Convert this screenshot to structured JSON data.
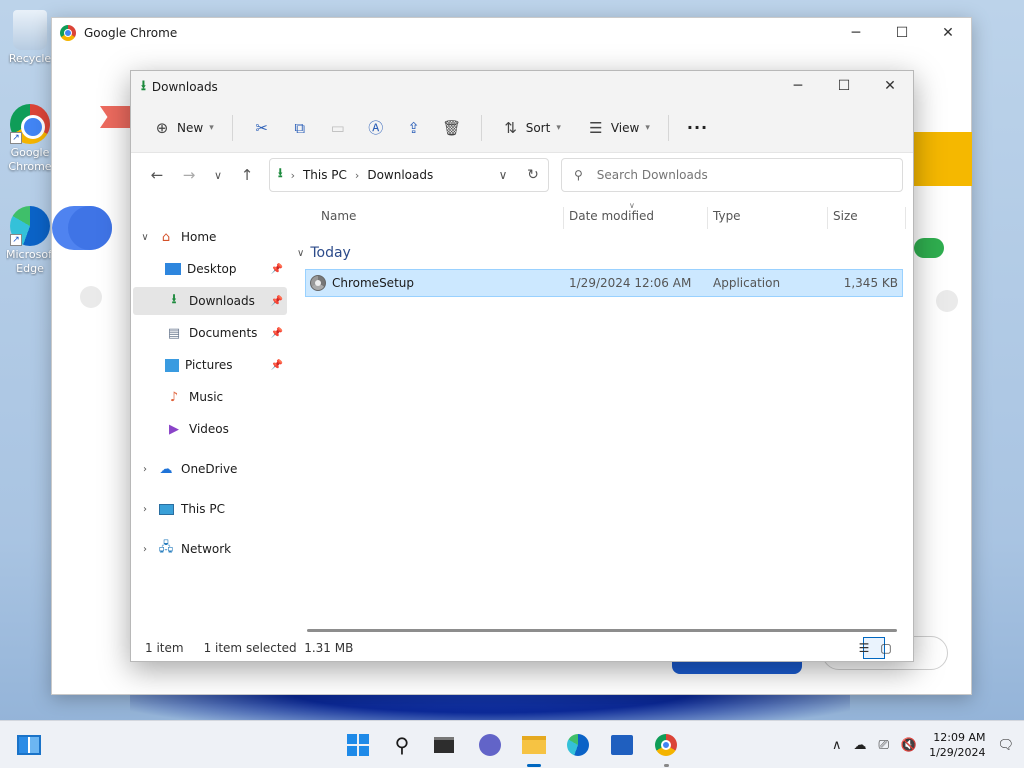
{
  "desktop": {
    "icons": [
      {
        "label": "Recycle",
        "icon": "recycle-bin-icon"
      },
      {
        "label": "Google Chrome",
        "icon": "chrome-icon"
      },
      {
        "label": "Microsoft Edge",
        "icon": "edge-icon"
      }
    ]
  },
  "chrome_window": {
    "title": "Google Chrome"
  },
  "explorer": {
    "title": "Downloads",
    "toolbar": {
      "new_label": "New",
      "sort_label": "Sort",
      "view_label": "View",
      "more_label": "···"
    },
    "address": {
      "crumbs": [
        "This PC",
        "Downloads"
      ]
    },
    "search": {
      "placeholder": "Search Downloads"
    },
    "nav": {
      "home": "Home",
      "quick_access": [
        {
          "label": "Desktop",
          "pinned": true
        },
        {
          "label": "Downloads",
          "pinned": true,
          "selected": true
        },
        {
          "label": "Documents",
          "pinned": true
        },
        {
          "label": "Pictures",
          "pinned": true
        },
        {
          "label": "Music",
          "pinned": false
        },
        {
          "label": "Videos",
          "pinned": false
        }
      ],
      "roots": [
        "OneDrive",
        "This PC",
        "Network"
      ]
    },
    "columns": [
      "Name",
      "Date modified",
      "Type",
      "Size"
    ],
    "group_label": "Today",
    "files": [
      {
        "name": "ChromeSetup",
        "date": "1/29/2024 12:06 AM",
        "type": "Application",
        "size": "1,345 KB"
      }
    ],
    "status": {
      "count": "1 item",
      "selection": "1 item selected  1.31 MB"
    }
  },
  "taskbar": {
    "clock_time": "12:09 AM",
    "clock_date": "1/29/2024"
  },
  "colors": {
    "accent": "#0067c0",
    "selection": "#cce8ff",
    "download_green": "#1c8a3d"
  }
}
